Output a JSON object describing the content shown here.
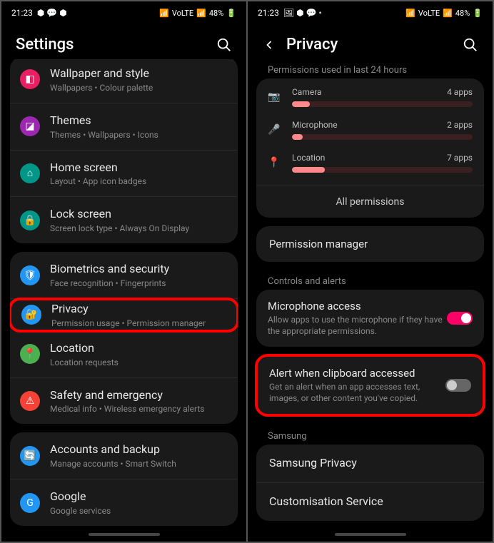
{
  "left": {
    "status": {
      "time": "21:23",
      "battery": "48%",
      "network": "VoLTE"
    },
    "title": "Settings",
    "groups": [
      {
        "items": [
          {
            "icon": "wallpaper",
            "title": "Wallpaper and style",
            "sub": "Wallpapers  •  Colour palette",
            "color": "pink"
          },
          {
            "icon": "themes",
            "title": "Themes",
            "sub": "Themes  •  Wallpapers  •  Icons",
            "color": "purple"
          },
          {
            "icon": "home",
            "title": "Home screen",
            "sub": "Layout  •  App icon badges",
            "color": "teal"
          },
          {
            "icon": "lock",
            "title": "Lock screen",
            "sub": "Screen lock type  •  Always On Display",
            "color": "lock"
          }
        ]
      },
      {
        "items": [
          {
            "icon": "shield",
            "title": "Biometrics and security",
            "sub": "Face recognition  •  Fingerprints",
            "color": "blue"
          },
          {
            "icon": "shield-lock",
            "title": "Privacy",
            "sub": "Permission usage  •  Permission manager",
            "color": "blue",
            "highlight": true
          },
          {
            "icon": "location",
            "title": "Location",
            "sub": "Location requests",
            "color": "green"
          },
          {
            "icon": "emergency",
            "title": "Safety and emergency",
            "sub": "Medical info  •  Wireless emergency alerts",
            "color": "red"
          }
        ]
      },
      {
        "items": [
          {
            "icon": "sync",
            "title": "Accounts and backup",
            "sub": "Manage accounts  •  Smart Switch",
            "color": "blue"
          },
          {
            "icon": "google",
            "title": "Google",
            "sub": "Google services",
            "color": "blue"
          }
        ]
      }
    ]
  },
  "right": {
    "status": {
      "time": "21:23",
      "battery": "48%",
      "network": "VoLTE"
    },
    "title": "Privacy",
    "perm_label": "Permissions used in last 24 hours",
    "permissions": [
      {
        "name": "Camera",
        "count": "4 apps",
        "fill": 10,
        "icon": "camera",
        "color": "#e66"
      },
      {
        "name": "Microphone",
        "count": "2 apps",
        "fill": 6,
        "icon": "mic",
        "color": "#66f"
      },
      {
        "name": "Location",
        "count": "7 apps",
        "fill": 18,
        "icon": "pin",
        "color": "#2c6"
      }
    ],
    "all_permissions": "All permissions",
    "permission_manager": "Permission manager",
    "controls_label": "Controls and alerts",
    "mic_access": {
      "title": "Microphone access",
      "sub": "Allow apps to use the microphone if they have the appropriate permissions.",
      "on": true
    },
    "clipboard": {
      "title": "Alert when clipboard accessed",
      "sub": "Get an alert when an app accesses text, images, or other content you've copied.",
      "on": false,
      "highlight": true
    },
    "samsung_label": "Samsung",
    "samsung_privacy": "Samsung Privacy",
    "customisation": "Customisation Service"
  }
}
